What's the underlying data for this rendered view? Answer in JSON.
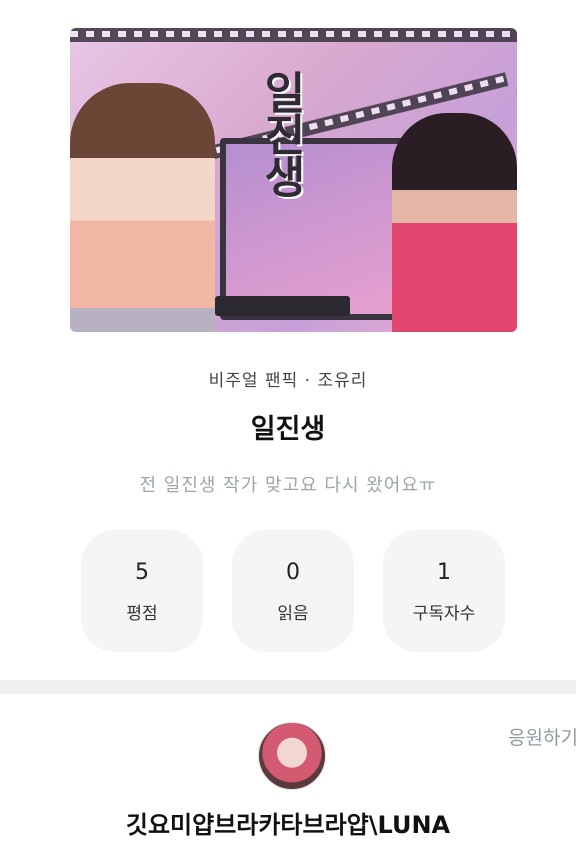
{
  "cover": {
    "title": "일진생",
    "badge": ""
  },
  "novel": {
    "category": "비주얼 팬픽 · 조유리",
    "title": "일진생",
    "description": "전 일진생 작가 맞고요 다시 왔어요ㅠ"
  },
  "stats": [
    {
      "value": "5",
      "label": "평점"
    },
    {
      "value": "0",
      "label": "읽음"
    },
    {
      "value": "1",
      "label": "구독자수"
    }
  ],
  "author": {
    "name": "깃요미얍브라카타브라얍\\LUNA",
    "cheer_label": "응원하기"
  }
}
